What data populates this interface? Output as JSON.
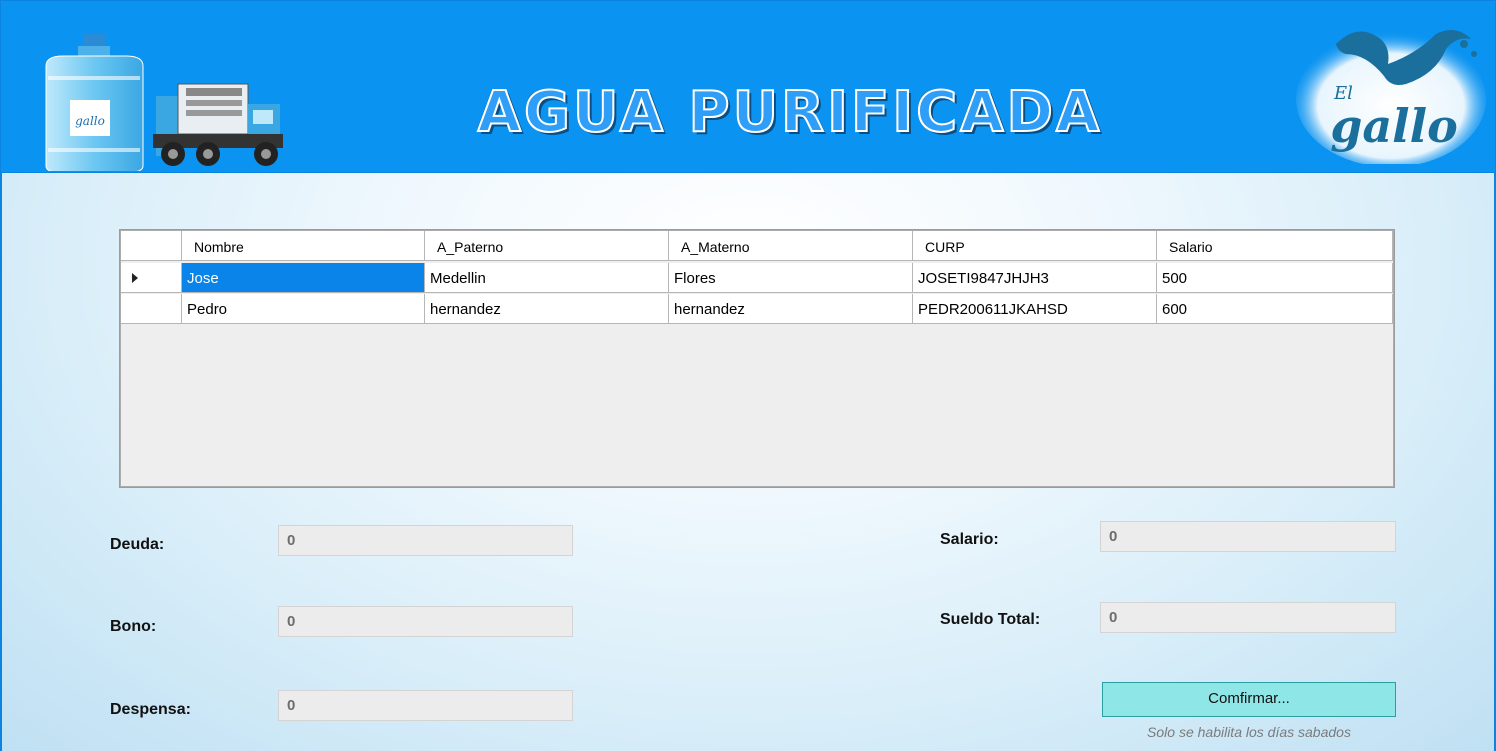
{
  "header": {
    "title": "AGUA PURIFICADA",
    "logo_left_icon": "water-bottle-truck-icon",
    "logo_right_icon": "el-gallo-rooster-logo",
    "logo_right_text_top": "El",
    "logo_right_text_bottom": "gallo",
    "bottle_label": "gallo",
    "brand_color": "#0a93f0"
  },
  "grid": {
    "columns": [
      "Nombre",
      "A_Paterno",
      "A_Materno",
      "CURP",
      "Salario"
    ],
    "rows": [
      {
        "nombre": "Jose",
        "a_paterno": "Medellin",
        "a_materno": "Flores",
        "curp": "JOSETI9847JHJH3",
        "salario": "500"
      },
      {
        "nombre": "Pedro",
        "a_paterno": "hernandez",
        "a_materno": "hernandez",
        "curp": "PEDR200611JKAHSD",
        "salario": "600"
      }
    ]
  },
  "form": {
    "deuda_label": "Deuda:",
    "deuda_value": "0",
    "bono_label": "Bono:",
    "bono_value": "0",
    "despensa_label": "Despensa:",
    "despensa_value": "0",
    "salario_label": "Salario:",
    "salario_value": "0",
    "sueldo_total_label": "Sueldo Total:",
    "sueldo_total_value": "0"
  },
  "actions": {
    "confirm_label": "Comfirmar...",
    "confirm_hint": "Solo se habilita los días sabados"
  }
}
